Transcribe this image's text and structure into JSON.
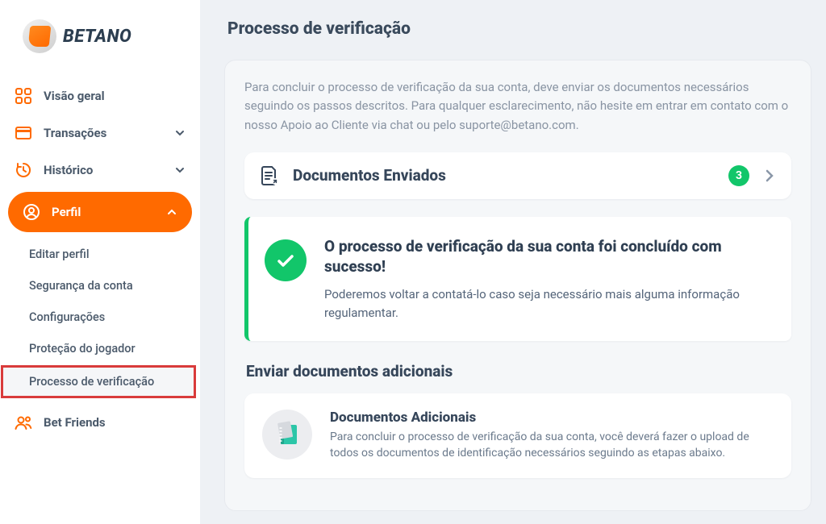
{
  "brand": {
    "name": "BETANO"
  },
  "sidebar": {
    "items": [
      {
        "label": "Visão geral"
      },
      {
        "label": "Transações"
      },
      {
        "label": "Histórico"
      },
      {
        "label": "Perfil"
      },
      {
        "label": "Bet Friends"
      }
    ],
    "profile_sub": [
      {
        "label": "Editar perfil"
      },
      {
        "label": "Segurança da conta"
      },
      {
        "label": "Configurações"
      },
      {
        "label": "Proteção do jogador"
      },
      {
        "label": "Processo de verificação"
      }
    ]
  },
  "page": {
    "title": "Processo de verificação",
    "intro": "Para concluir o processo de verificação da sua conta, deve enviar os documentos necessários seguindo os passos descritos. Para qualquer esclarecimento, não hesite em entrar em contato com o nosso Apoio ao Cliente via chat ou pelo suporte@betano.com.",
    "sent_docs": {
      "title": "Documentos Enviados",
      "count": "3"
    },
    "success": {
      "title": "O processo de verificação da sua conta foi concluído com sucesso!",
      "body": "Poderemos voltar a contatá-lo caso seja necessário mais alguma informação regulamentar."
    },
    "additional": {
      "heading": "Enviar documentos adicionais",
      "title": "Documentos Adicionais",
      "body": "Para concluir o processo de verificação da sua conta, você deverá fazer o upload de todos os documentos de identificação necessários seguindo as etapas abaixo."
    }
  }
}
